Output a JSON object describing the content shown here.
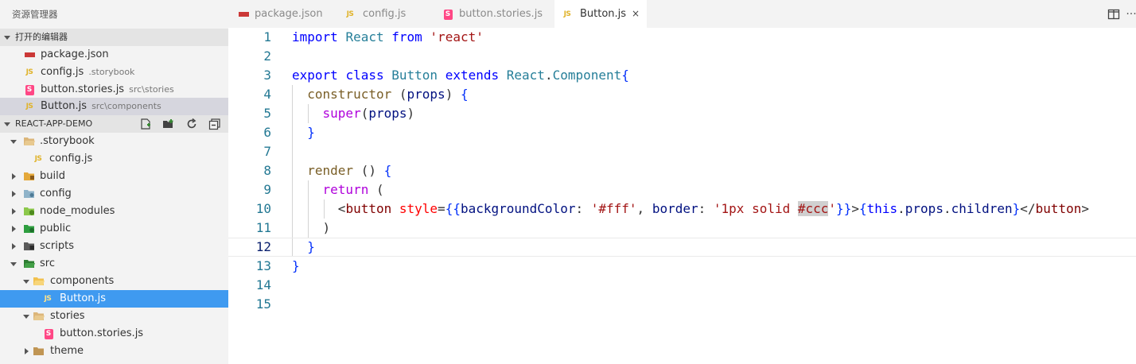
{
  "explorer": {
    "title": "资源管理器",
    "open_editors_header": "打开的编辑器",
    "open_editors": [
      {
        "name": "package.json",
        "desc": "",
        "icon": "npm-icon"
      },
      {
        "name": "config.js",
        "desc": ".storybook",
        "icon": "js-icon"
      },
      {
        "name": "button.stories.js",
        "desc": "src\\stories",
        "icon": "storybook-icon"
      },
      {
        "name": "Button.js",
        "desc": "src\\components",
        "icon": "js-icon"
      }
    ],
    "project_header": "REACT-APP-DEMO",
    "tree": [
      {
        "name": ".storybook"
      },
      {
        "name": "config.js"
      },
      {
        "name": "build"
      },
      {
        "name": "config"
      },
      {
        "name": "node_modules"
      },
      {
        "name": "public"
      },
      {
        "name": "scripts"
      },
      {
        "name": "src"
      },
      {
        "name": "components"
      },
      {
        "name": "Button.js"
      },
      {
        "name": "stories"
      },
      {
        "name": "button.stories.js"
      },
      {
        "name": "theme"
      }
    ],
    "js_icon_text": "JS",
    "storybook_icon_text": "S"
  },
  "tabs": [
    {
      "label": "package.json",
      "active": false
    },
    {
      "label": "config.js",
      "active": false
    },
    {
      "label": "button.stories.js",
      "active": false
    },
    {
      "label": "Button.js",
      "active": true
    }
  ],
  "tab_close_glyph": "×",
  "more_glyph": "···",
  "code": {
    "line_numbers": [
      "1",
      "2",
      "3",
      "4",
      "5",
      "6",
      "7",
      "8",
      "9",
      "10",
      "11",
      "12",
      "13",
      "14",
      "15"
    ],
    "current_line": 12,
    "lines": [
      "import React from 'react'",
      "",
      "export class Button extends React.Component{",
      "  constructor (props) {",
      "    super(props)",
      "  }",
      "",
      "  render () {",
      "    return (",
      "      <button style={{backgroundColor: '#fff', border: '1px solid #ccc'}}>{this.props.children}</button>",
      "    )",
      "  }",
      "}",
      "",
      ""
    ]
  },
  "colors": {
    "keyword": "#0000ff",
    "control": "#af00db",
    "class": "#267f99",
    "string": "#a31515",
    "tag": "#800000",
    "attribute": "#ff0000",
    "variable": "#001080",
    "line_number": "#237893",
    "active_row": "#3f9af0",
    "js_icon": "#e0b32a",
    "npm_icon": "#cb3837",
    "storybook_icon": "#ff4785"
  }
}
